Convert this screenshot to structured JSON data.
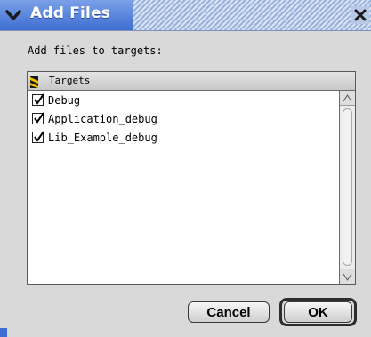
{
  "window": {
    "title": "Add Files",
    "collapse_icon": "chevron-down-icon",
    "close_icon": "close-icon"
  },
  "prompt": "Add files to targets:",
  "list": {
    "header": "Targets",
    "header_icon": "target-stripe-icon",
    "items": [
      {
        "label": "Debug",
        "checked": true
      },
      {
        "label": "Application_debug",
        "checked": true
      },
      {
        "label": "Lib_Example_debug",
        "checked": true
      }
    ]
  },
  "buttons": {
    "cancel": "Cancel",
    "ok": "OK"
  },
  "colors": {
    "title_bar": "#3e6ed0",
    "title_text": "#ffffff"
  }
}
